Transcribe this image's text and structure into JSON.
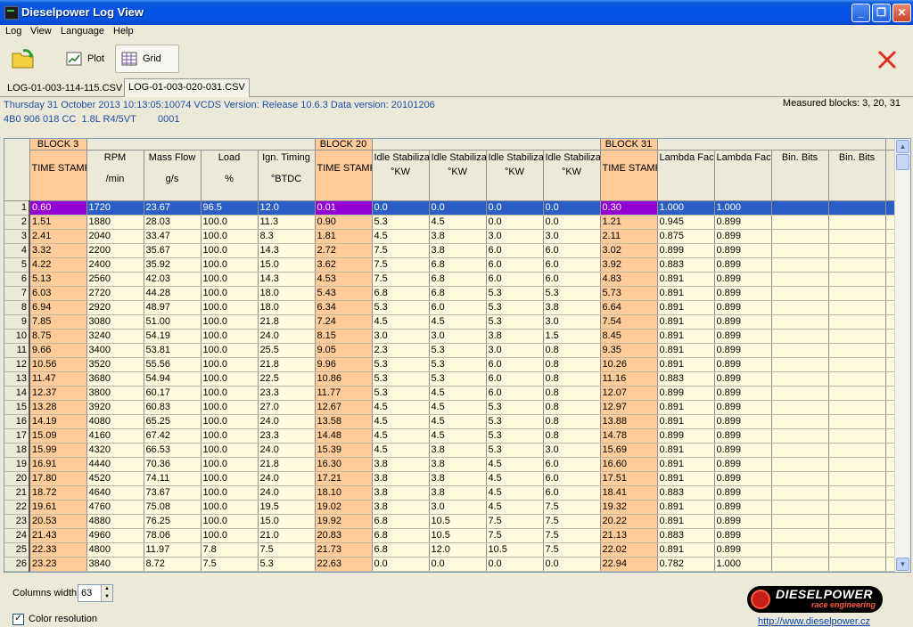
{
  "window": {
    "title": "Dieselpower Log View"
  },
  "menu": [
    "Log",
    "View",
    "Language",
    "Help"
  ],
  "toolbar": {
    "plot_label": "Plot",
    "grid_label": "Grid"
  },
  "tabs": [
    "LOG-01-003-114-115.CSV",
    "LOG-01-003-020-031.CSV"
  ],
  "info": {
    "line1": "Thursday 31 October 2013 10:13:05:10074 VCDS Version: Release 10.6.3 Data version: 20101206",
    "line2": "4B0 906 018 CC  1.8L R4/5VT        0001",
    "measured": "Measured blocks: 3, 20, 31"
  },
  "grid": {
    "block_headers": [
      {
        "label": "BLOCK 3",
        "span": 1,
        "highlight": true
      },
      {
        "label": "",
        "span": 4,
        "highlight": false
      },
      {
        "label": "BLOCK 20",
        "span": 1,
        "highlight": true
      },
      {
        "label": "",
        "span": 4,
        "highlight": false
      },
      {
        "label": "BLOCK 31",
        "span": 1,
        "highlight": true
      },
      {
        "label": "",
        "span": 4,
        "highlight": false
      }
    ],
    "columns": [
      {
        "name": "TIME STAMP",
        "unit": "",
        "ts": true
      },
      {
        "name": "RPM",
        "unit": "/min",
        "ts": false
      },
      {
        "name": "Mass Flow",
        "unit": "g/s",
        "ts": false
      },
      {
        "name": "Load",
        "unit": "%",
        "ts": false
      },
      {
        "name": "Ign. Timing",
        "unit": "°BTDC",
        "ts": false
      },
      {
        "name": "TIME STAMP",
        "unit": "",
        "ts": true
      },
      {
        "name": "Idle Stabilization",
        "unit": "°KW",
        "ts": false
      },
      {
        "name": "Idle Stabilization",
        "unit": "°KW",
        "ts": false
      },
      {
        "name": "Idle Stabilization",
        "unit": "°KW",
        "ts": false
      },
      {
        "name": "Idle Stabilization",
        "unit": "°KW",
        "ts": false
      },
      {
        "name": "TIME STAMP",
        "unit": "",
        "ts": true
      },
      {
        "name": "Lambda Factor",
        "unit": "",
        "ts": false
      },
      {
        "name": "Lambda Factor",
        "unit": "",
        "ts": false
      },
      {
        "name": "Bin. Bits",
        "unit": "",
        "ts": false
      },
      {
        "name": "Bin. Bits",
        "unit": "",
        "ts": false
      }
    ],
    "selected_row": 1,
    "rows": [
      [
        "0.60",
        "1720",
        "23.67",
        "96.5",
        "12.0",
        "0.01",
        "0.0",
        "0.0",
        "0.0",
        "0.0",
        "0.30",
        "1.000",
        "1.000",
        "",
        ""
      ],
      [
        "1.51",
        "1880",
        "28.03",
        "100.0",
        "11.3",
        "0.90",
        "5.3",
        "4.5",
        "0.0",
        "0.0",
        "1.21",
        "0.945",
        "0.899",
        "",
        ""
      ],
      [
        "2.41",
        "2040",
        "33.47",
        "100.0",
        "8.3",
        "1.81",
        "4.5",
        "3.8",
        "3.0",
        "3.0",
        "2.11",
        "0.875",
        "0.899",
        "",
        ""
      ],
      [
        "3.32",
        "2200",
        "35.67",
        "100.0",
        "14.3",
        "2.72",
        "7.5",
        "3.8",
        "6.0",
        "6.0",
        "3.02",
        "0.899",
        "0.899",
        "",
        ""
      ],
      [
        "4.22",
        "2400",
        "35.92",
        "100.0",
        "15.0",
        "3.62",
        "7.5",
        "6.8",
        "6.0",
        "6.0",
        "3.92",
        "0.883",
        "0.899",
        "",
        ""
      ],
      [
        "5.13",
        "2560",
        "42.03",
        "100.0",
        "14.3",
        "4.53",
        "7.5",
        "6.8",
        "6.0",
        "6.0",
        "4.83",
        "0.891",
        "0.899",
        "",
        ""
      ],
      [
        "6.03",
        "2720",
        "44.28",
        "100.0",
        "18.0",
        "5.43",
        "6.8",
        "6.8",
        "5.3",
        "5.3",
        "5.73",
        "0.891",
        "0.899",
        "",
        ""
      ],
      [
        "6.94",
        "2920",
        "48.97",
        "100.0",
        "18.0",
        "6.34",
        "5.3",
        "6.0",
        "5.3",
        "3.8",
        "6.64",
        "0.891",
        "0.899",
        "",
        ""
      ],
      [
        "7.85",
        "3080",
        "51.00",
        "100.0",
        "21.8",
        "7.24",
        "4.5",
        "4.5",
        "5.3",
        "3.0",
        "7.54",
        "0.891",
        "0.899",
        "",
        ""
      ],
      [
        "8.75",
        "3240",
        "54.19",
        "100.0",
        "24.0",
        "8.15",
        "3.0",
        "3.0",
        "3.8",
        "1.5",
        "8.45",
        "0.891",
        "0.899",
        "",
        ""
      ],
      [
        "9.66",
        "3400",
        "53.81",
        "100.0",
        "25.5",
        "9.05",
        "2.3",
        "5.3",
        "3.0",
        "0.8",
        "9.35",
        "0.891",
        "0.899",
        "",
        ""
      ],
      [
        "10.56",
        "3520",
        "55.56",
        "100.0",
        "21.8",
        "9.96",
        "5.3",
        "5.3",
        "6.0",
        "0.8",
        "10.26",
        "0.891",
        "0.899",
        "",
        ""
      ],
      [
        "11.47",
        "3680",
        "54.94",
        "100.0",
        "22.5",
        "10.86",
        "5.3",
        "5.3",
        "6.0",
        "0.8",
        "11.16",
        "0.883",
        "0.899",
        "",
        ""
      ],
      [
        "12.37",
        "3800",
        "60.17",
        "100.0",
        "23.3",
        "11.77",
        "5.3",
        "4.5",
        "6.0",
        "0.8",
        "12.07",
        "0.899",
        "0.899",
        "",
        ""
      ],
      [
        "13.28",
        "3920",
        "60.83",
        "100.0",
        "27.0",
        "12.67",
        "4.5",
        "4.5",
        "5.3",
        "0.8",
        "12.97",
        "0.891",
        "0.899",
        "",
        ""
      ],
      [
        "14.19",
        "4080",
        "65.25",
        "100.0",
        "24.0",
        "13.58",
        "4.5",
        "4.5",
        "5.3",
        "0.8",
        "13.88",
        "0.891",
        "0.899",
        "",
        ""
      ],
      [
        "15.09",
        "4160",
        "67.42",
        "100.0",
        "23.3",
        "14.48",
        "4.5",
        "4.5",
        "5.3",
        "0.8",
        "14.78",
        "0.899",
        "0.899",
        "",
        ""
      ],
      [
        "15.99",
        "4320",
        "66.53",
        "100.0",
        "24.0",
        "15.39",
        "4.5",
        "3.8",
        "5.3",
        "3.0",
        "15.69",
        "0.891",
        "0.899",
        "",
        ""
      ],
      [
        "16.91",
        "4440",
        "70.36",
        "100.0",
        "21.8",
        "16.30",
        "3.8",
        "3.8",
        "4.5",
        "6.0",
        "16.60",
        "0.891",
        "0.899",
        "",
        ""
      ],
      [
        "17.80",
        "4520",
        "74.11",
        "100.0",
        "24.0",
        "17.21",
        "3.8",
        "3.8",
        "4.5",
        "6.0",
        "17.51",
        "0.891",
        "0.899",
        "",
        ""
      ],
      [
        "18.72",
        "4640",
        "73.67",
        "100.0",
        "24.0",
        "18.10",
        "3.8",
        "3.8",
        "4.5",
        "6.0",
        "18.41",
        "0.883",
        "0.899",
        "",
        ""
      ],
      [
        "19.61",
        "4760",
        "75.08",
        "100.0",
        "19.5",
        "19.02",
        "3.8",
        "3.0",
        "4.5",
        "7.5",
        "19.32",
        "0.891",
        "0.899",
        "",
        ""
      ],
      [
        "20.53",
        "4880",
        "76.25",
        "100.0",
        "15.0",
        "19.92",
        "6.8",
        "10.5",
        "7.5",
        "7.5",
        "20.22",
        "0.891",
        "0.899",
        "",
        ""
      ],
      [
        "21.43",
        "4960",
        "78.06",
        "100.0",
        "21.0",
        "20.83",
        "6.8",
        "10.5",
        "7.5",
        "7.5",
        "21.13",
        "0.883",
        "0.899",
        "",
        ""
      ],
      [
        "22.33",
        "4800",
        "11.97",
        "7.8",
        "7.5",
        "21.73",
        "6.8",
        "12.0",
        "10.5",
        "7.5",
        "22.02",
        "0.891",
        "0.899",
        "",
        ""
      ],
      [
        "23.23",
        "3840",
        "8.72",
        "7.5",
        "5.3",
        "22.63",
        "0.0",
        "0.0",
        "0.0",
        "0.0",
        "22.94",
        "0.782",
        "1.000",
        "",
        ""
      ]
    ]
  },
  "bottom": {
    "columns_width_label": "Columns width:",
    "columns_width_value": "63",
    "color_resolution_label": "Color resolution",
    "logo_brand": "DIESELPOWER",
    "logo_sub": "race engineering",
    "url": "http://www.dieselpower.cz"
  }
}
